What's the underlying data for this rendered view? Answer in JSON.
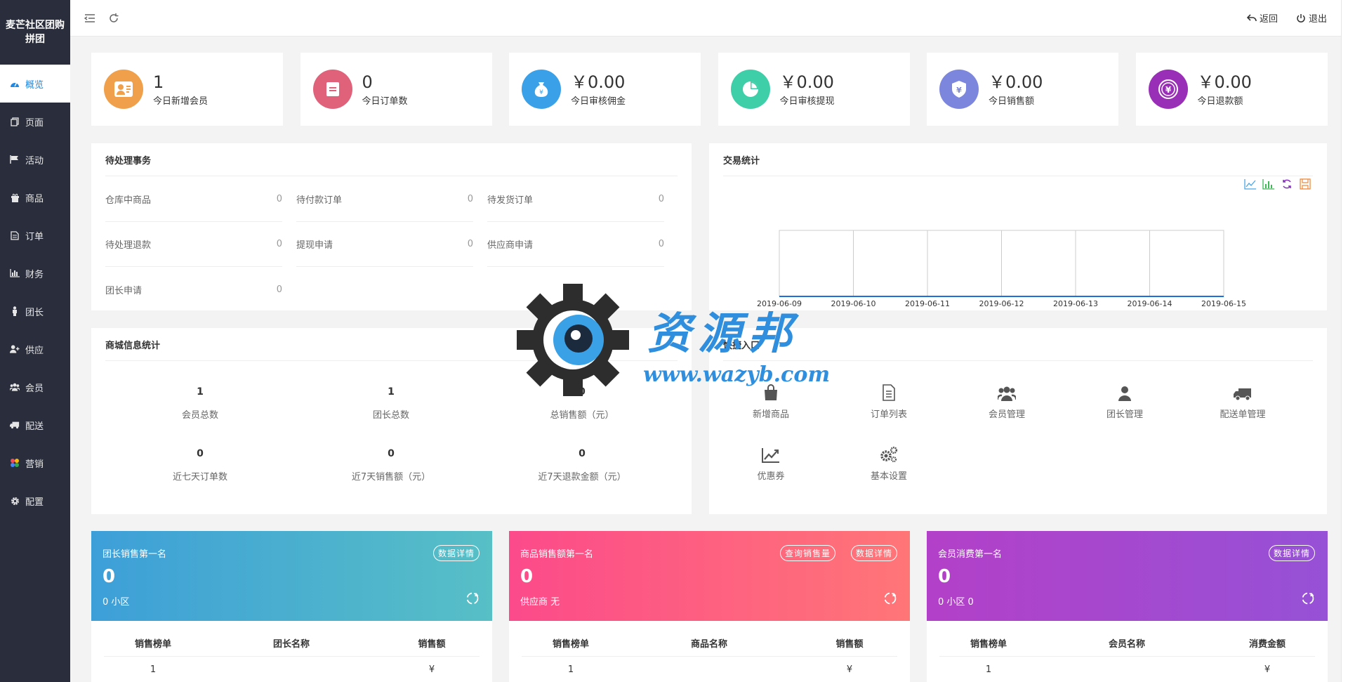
{
  "app": {
    "title": "麦芒社区团购拼团"
  },
  "topbar": {
    "back_label": "返回",
    "logout_label": "退出"
  },
  "sidebar": {
    "items": [
      {
        "label": "概览",
        "icon": "dashboard-icon",
        "active": true
      },
      {
        "label": "页面",
        "icon": "page-icon"
      },
      {
        "label": "活动",
        "icon": "flag-icon"
      },
      {
        "label": "商品",
        "icon": "gift-icon"
      },
      {
        "label": "订单",
        "icon": "document-icon"
      },
      {
        "label": "财务",
        "icon": "bar-chart-icon"
      },
      {
        "label": "团长",
        "icon": "person-icon"
      },
      {
        "label": "供应",
        "icon": "user-plus-icon"
      },
      {
        "label": "会员",
        "icon": "users-icon"
      },
      {
        "label": "配送",
        "icon": "truck-icon"
      },
      {
        "label": "营销",
        "icon": "marketing-icon"
      },
      {
        "label": "配置",
        "icon": "gear-icon"
      }
    ]
  },
  "stats": [
    {
      "value": "1",
      "label": "今日新增会员",
      "color": "#f0a04b"
    },
    {
      "value": "0",
      "label": "今日订单数",
      "color": "#e0627a"
    },
    {
      "value": "￥0.00",
      "label": "今日审核佣金",
      "color": "#3aa0e8"
    },
    {
      "value": "￥0.00",
      "label": "今日审核提现",
      "color": "#3fcfa8"
    },
    {
      "value": "￥0.00",
      "label": "今日销售额",
      "color": "#7d86dd"
    },
    {
      "value": "￥0.00",
      "label": "今日退款额",
      "color": "#9a2fb7"
    }
  ],
  "pending": {
    "title": "待处理事务",
    "items": [
      {
        "label": "仓库中商品",
        "value": "0"
      },
      {
        "label": "待付款订单",
        "value": "0"
      },
      {
        "label": "待发货订单",
        "value": "0"
      },
      {
        "label": "待处理退款",
        "value": "0"
      },
      {
        "label": "提现申请",
        "value": "0"
      },
      {
        "label": "供应商申请",
        "value": "0"
      },
      {
        "label": "团长申请",
        "value": "0"
      }
    ]
  },
  "trade": {
    "title": "交易统计"
  },
  "chart_data": {
    "type": "line",
    "x": [
      "2019-06-09",
      "2019-06-10",
      "2019-06-11",
      "2019-06-12",
      "2019-06-13",
      "2019-06-14",
      "2019-06-15"
    ],
    "series": [
      {
        "values": [
          0,
          0,
          0,
          0,
          0,
          0,
          0
        ],
        "color": "#1e6fd9"
      }
    ],
    "title": "",
    "grid": true
  },
  "mall": {
    "title": "商城信息统计",
    "items": [
      {
        "value": "1",
        "label": "会员总数"
      },
      {
        "value": "1",
        "label": "团长总数"
      },
      {
        "value": "0",
        "label": "总销售额（元）"
      },
      {
        "value": "0",
        "label": "近七天订单数"
      },
      {
        "value": "0",
        "label": "近7天销售额（元）"
      },
      {
        "value": "0",
        "label": "近7天退款金额（元）"
      }
    ]
  },
  "quick": {
    "title": "快捷入口",
    "items": [
      {
        "label": "新增商品",
        "icon": "shopping-bag-icon"
      },
      {
        "label": "订单列表",
        "icon": "file-icon"
      },
      {
        "label": "会员管理",
        "icon": "users-icon"
      },
      {
        "label": "团长管理",
        "icon": "person-icon"
      },
      {
        "label": "配送单管理",
        "icon": "truck-icon"
      },
      {
        "label": "优惠券",
        "icon": "trend-chart-icon"
      },
      {
        "label": "基本设置",
        "icon": "gears-icon"
      }
    ]
  },
  "rankings": [
    {
      "title": "团长销售第一名",
      "value": "0",
      "sub": "0 小区",
      "buttons": [
        "数据详情"
      ],
      "columns": [
        "销售榜单",
        "团长名称",
        "销售额"
      ],
      "row": [
        "1",
        "",
        "¥"
      ],
      "from": "#3d9fd8",
      "to": "#57bfc6"
    },
    {
      "title": "商品销售额第一名",
      "value": "0",
      "sub": "供应商 无",
      "buttons": [
        "查询销售量",
        "数据详情"
      ],
      "columns": [
        "销售榜单",
        "商品名称",
        "销售额"
      ],
      "row": [
        "1",
        "",
        "¥"
      ],
      "from": "#fc4a8a",
      "to": "#ff7677"
    },
    {
      "title": "会员消费第一名",
      "value": "0",
      "sub": "0 小区 0",
      "buttons": [
        "数据详情"
      ],
      "columns": [
        "销售榜单",
        "会员名称",
        "消费金额"
      ],
      "row": [
        "1",
        "",
        "¥"
      ],
      "from": "#b340c8",
      "to": "#9651d6"
    }
  ],
  "watermark": {
    "brand": "资源邦",
    "url": "www.wazyb.com"
  }
}
